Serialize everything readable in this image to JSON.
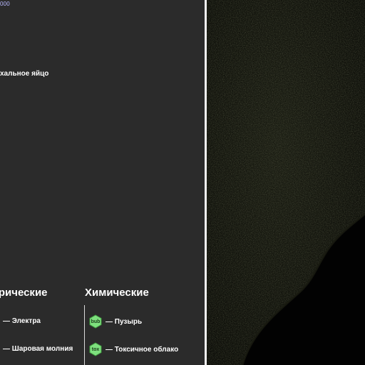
{
  "left": {
    "counter": "000",
    "item_label": "хальное яйцо",
    "categories": [
      {
        "title": "ктрические",
        "items": [
          {
            "label": "— Электра"
          },
          {
            "label": "— Шаровая молния"
          }
        ]
      },
      {
        "title": "Химические",
        "items": [
          {
            "badge": "bub",
            "label": "— Пузырь"
          },
          {
            "badge": "tox",
            "label": "— Токсичное облако"
          }
        ]
      }
    ]
  },
  "colors": {
    "panel_bg": "#2b2b2b",
    "counter_text": "#b8b8ff",
    "badge_fill": "#7ee07e",
    "badge_stroke": "#3f9a3f"
  },
  "icons": {
    "badge_shape": "hexagon-icon"
  }
}
